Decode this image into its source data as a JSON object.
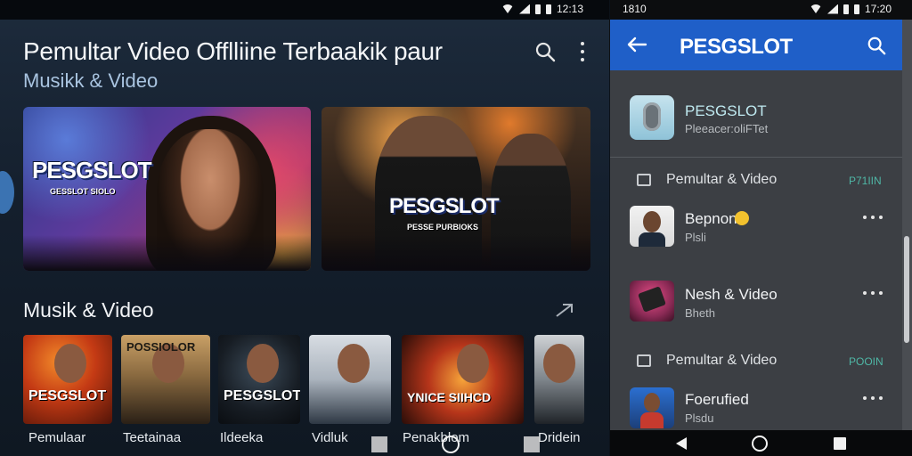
{
  "left": {
    "status": {
      "time": "12:13"
    },
    "title": "Pemultar Video Offlliine Terbaakik paur",
    "subtitle": "Musikk &  Video",
    "banners": [
      {
        "logo": "PESGSLOT",
        "tagline": "GESSLOT SIOLO"
      },
      {
        "logo": "PESGSLOT",
        "tagline": "PESSE PURBIOKS"
      }
    ],
    "section_title": "Musik & Video",
    "thumbs": [
      {
        "logo": "PESGSLOT",
        "label": "Pemulaar"
      },
      {
        "logo": "POSSIOLOR",
        "label": "Teetainaa"
      },
      {
        "logo": "PESGSLOT",
        "label": "Ildeeka"
      },
      {
        "logo": "",
        "label": "Vidluk"
      },
      {
        "logo": "YNICE SIIHCD",
        "label": "Penakblom"
      },
      {
        "logo": "",
        "label": "Dridein"
      }
    ]
  },
  "right": {
    "status": {
      "time_left": "1810",
      "time_right": "17:20"
    },
    "appbar": {
      "brand": "PESGSLOT"
    },
    "app": {
      "name": "PESGSLOT",
      "sub": "Pleeacer:oliFTet"
    },
    "sections": [
      {
        "label": "Pemultar & Video",
        "right": "P71IIN"
      },
      {
        "label": "Pemultar & Video",
        "right": "POOIN"
      }
    ],
    "items": [
      {
        "title": "Bepnon",
        "sub": "Plsli"
      },
      {
        "title": "Nesh & Video",
        "sub": "Bheth"
      },
      {
        "title": "Foerufied",
        "sub": "Plsdu"
      }
    ]
  },
  "colors": {
    "appbar": "#1f5fc8",
    "accent_green": "#4fb7a6",
    "left_bg": "#141f2d",
    "right_panel": "#3c3f44"
  }
}
